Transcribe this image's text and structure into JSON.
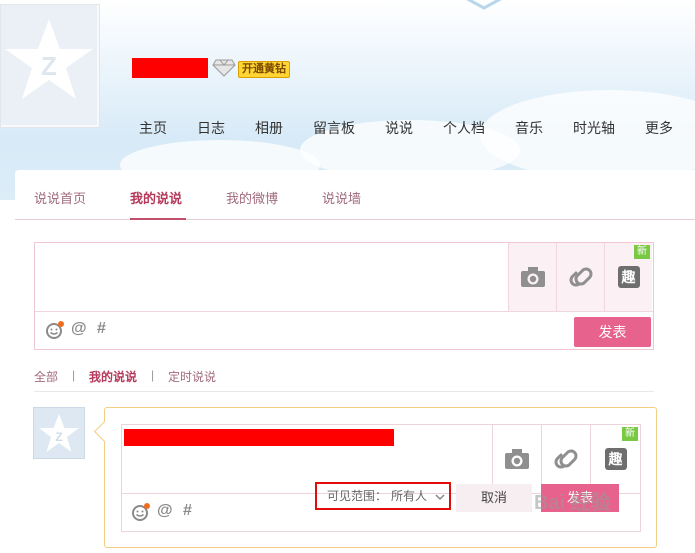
{
  "header": {
    "vip_label": "开通黄钻",
    "nav": [
      "主页",
      "日志",
      "相册",
      "留言板",
      "说说",
      "个人档",
      "音乐",
      "时光轴",
      "更多"
    ]
  },
  "tabs": [
    {
      "label": "说说首页",
      "active": false
    },
    {
      "label": "我的说说",
      "active": true
    },
    {
      "label": "我的微博",
      "active": false
    },
    {
      "label": "说说墙",
      "active": false
    }
  ],
  "composer": {
    "tool_icons": [
      "camera-icon",
      "link-icon",
      "fun-icon"
    ],
    "new_badge": "新",
    "fun_label": "趣",
    "publish_label": "发表"
  },
  "filters": {
    "items": [
      {
        "label": "全部",
        "active": false
      },
      {
        "label": "我的说说",
        "active": true
      },
      {
        "label": "定时说说",
        "active": false
      }
    ],
    "separator": "|"
  },
  "reply": {
    "visibility_label": "可见范围：",
    "visibility_value": "所有人",
    "cancel_label": "取消",
    "publish_label": "发表",
    "new_badge": "新",
    "fun_label": "趣"
  },
  "watermark": "Bai 经验",
  "colors": {
    "accent": "#e7628c",
    "tab_active": "#b4395a",
    "highlight_box": "#e10d0d",
    "reply_border": "#f3cd83"
  }
}
